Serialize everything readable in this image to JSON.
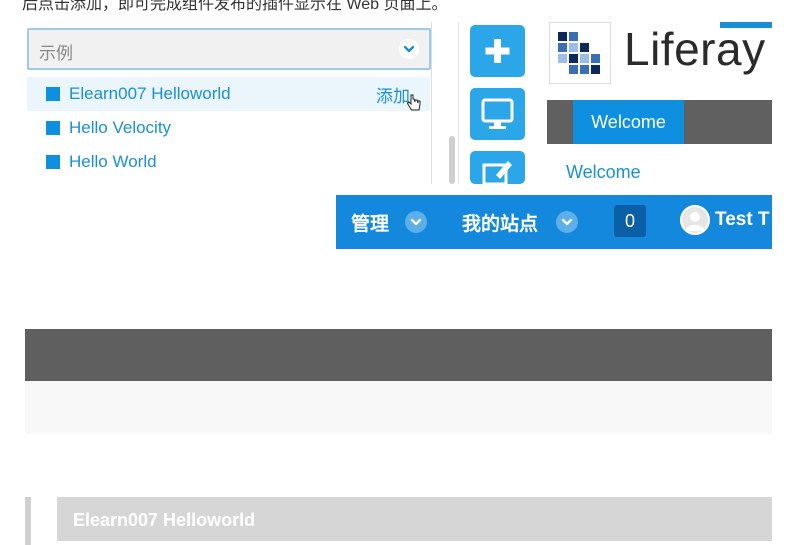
{
  "top_text": "后点击添加，即可完成组件发布的插件显示在 Web 页面上。",
  "select": {
    "placeholder": "示例"
  },
  "list": [
    {
      "label": "Elearn007 Helloworld",
      "action": "添加"
    },
    {
      "label": "Hello Velocity"
    },
    {
      "label": "Hello World"
    }
  ],
  "logo": {
    "text": "Liferay"
  },
  "nav": {
    "tab": "Welcome",
    "link": "Welcome"
  },
  "dockbar": {
    "admin": "管理",
    "my_sites": "我的站点",
    "count": "0",
    "user": "Test T"
  },
  "portlet": {
    "title": "Elearn007 Helloworld"
  },
  "colors": {
    "accent": "#1488dd",
    "dark_bar": "#5f5f5f"
  },
  "icons": [
    "chevron-down-icon",
    "plus-icon",
    "monitor-icon",
    "edit-icon",
    "cursor-hand-icon",
    "avatar-icon",
    "liferay-logo-icon"
  ]
}
